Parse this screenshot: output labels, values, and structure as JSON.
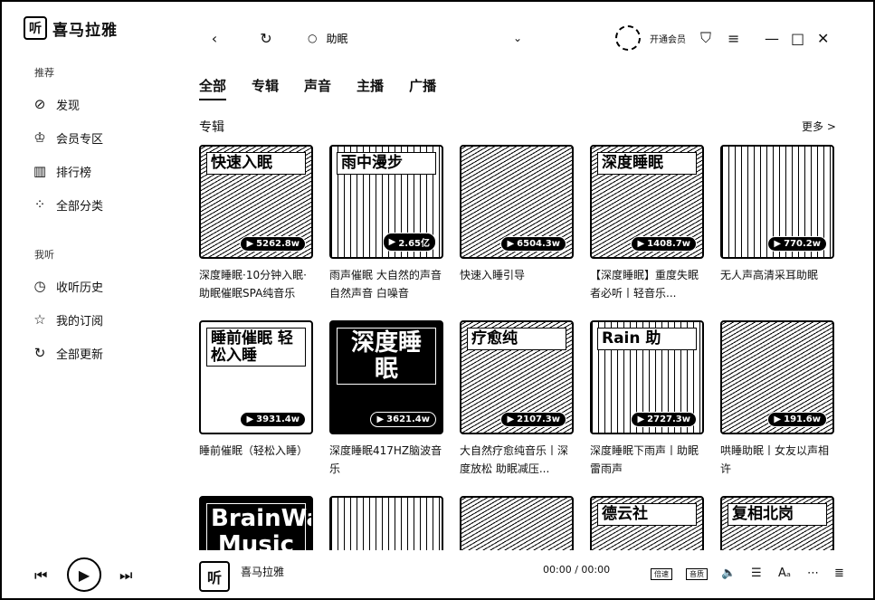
{
  "app": {
    "name": "喜马拉雅",
    "logo_glyph": "听"
  },
  "sidebar": {
    "recommend_header": "推荐",
    "recommend_items": [
      {
        "label": "发现",
        "icon": "compass-icon"
      },
      {
        "label": "会员专区",
        "icon": "crown-icon"
      },
      {
        "label": "排行榜",
        "icon": "podium-icon"
      },
      {
        "label": "全部分类",
        "icon": "grid-icon"
      }
    ],
    "mine_header": "我听",
    "mine_items": [
      {
        "label": "收听历史",
        "icon": "clock-icon"
      },
      {
        "label": "我的订阅",
        "icon": "star-icon"
      },
      {
        "label": "全部更新",
        "icon": "refresh-icon"
      }
    ]
  },
  "topbar": {
    "search_value": "助眠",
    "open_vip": "开通会员"
  },
  "tabs": [
    "全部",
    "专辑",
    "声音",
    "主播",
    "广播"
  ],
  "active_tab": 0,
  "section": {
    "title": "专辑",
    "more": "更多 >"
  },
  "albums": [
    {
      "title": "深度睡眠·10分钟入眠·助眠催眠SPA纯音乐",
      "plays": "5262.8w",
      "cover_text": "快速入眠",
      "style": "alt"
    },
    {
      "title": "雨声催眠 大自然的声音 自然声音 白噪音",
      "plays": "2.65亿",
      "cover_text": "雨中漫步",
      "style": "light"
    },
    {
      "title": "快速入睡引导",
      "plays": "6504.3w",
      "cover_text": "",
      "style": "alt"
    },
    {
      "title": "【深度睡眠】重度失眠者必听丨轻音乐...",
      "plays": "1408.7w",
      "cover_text": "深度睡眠",
      "style": "alt"
    },
    {
      "title": "无人声高清采耳助眠",
      "plays": "770.2w",
      "cover_text": "",
      "style": "light"
    },
    {
      "title": "睡前催眠（轻松入睡）",
      "plays": "3931.4w",
      "cover_text": "睡前催眠 轻松入睡",
      "style": "plain"
    },
    {
      "title": "深度睡眠417HZ脑波音乐",
      "plays": "3621.4w",
      "cover_text": "深度睡眠",
      "style": "dark"
    },
    {
      "title": "大自然疗愈纯音乐丨深度放松 助眠减压...",
      "plays": "2107.3w",
      "cover_text": "疗愈纯",
      "style": "alt"
    },
    {
      "title": "深度睡眠下雨声丨助眠雷雨声",
      "plays": "2727.3w",
      "cover_text": "Rain 助",
      "style": "light"
    },
    {
      "title": "哄睡助眠丨女友以声相许",
      "plays": "191.6w",
      "cover_text": "",
      "style": "alt"
    },
    {
      "title": "",
      "plays": "",
      "cover_text": "BrainWave Music",
      "style": "dark"
    },
    {
      "title": "",
      "plays": "",
      "cover_text": "",
      "style": "light"
    },
    {
      "title": "",
      "plays": "",
      "cover_text": "",
      "style": "alt"
    },
    {
      "title": "",
      "plays": "",
      "cover_text": "德云社",
      "style": "alt"
    },
    {
      "title": "",
      "plays": "",
      "cover_text": "复相北岗",
      "style": "alt"
    }
  ],
  "player": {
    "now_playing": "喜马拉雅",
    "time": "00:00 / 00:00",
    "speed_label": "倍速",
    "lyrics_label": "音质"
  }
}
